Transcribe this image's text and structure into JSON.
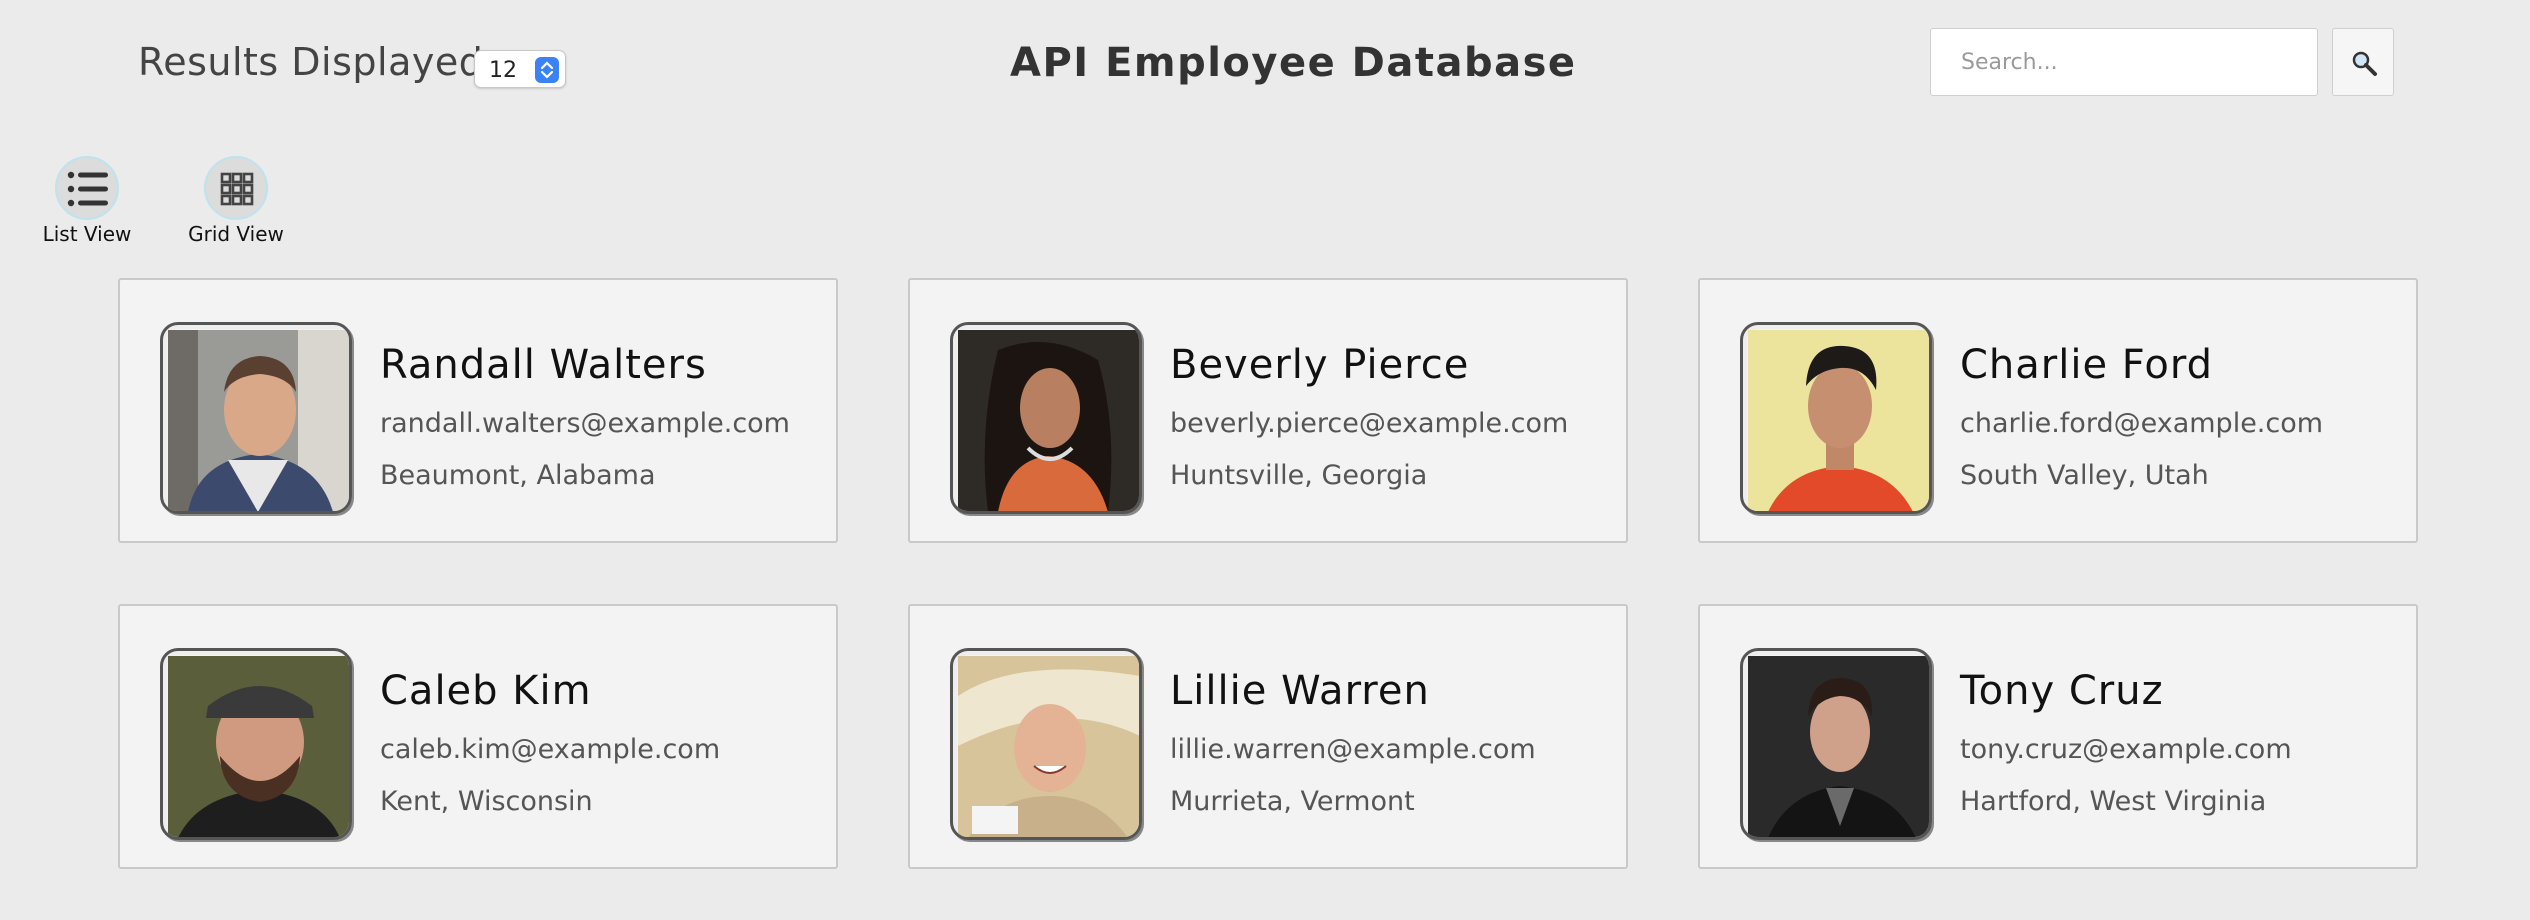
{
  "header": {
    "results_label": "Results Displayed",
    "results_value": "12",
    "title": "API Employee Database",
    "search_placeholder": "Search..."
  },
  "views": {
    "list_label": "List View",
    "grid_label": "Grid View"
  },
  "employees": [
    {
      "name": "Randall Walters",
      "email": "randall.walters@example.com",
      "location": "Beaumont, Alabama"
    },
    {
      "name": "Beverly Pierce",
      "email": "beverly.pierce@example.com",
      "location": "Huntsville, Georgia"
    },
    {
      "name": "Charlie Ford",
      "email": "charlie.ford@example.com",
      "location": "South Valley, Utah"
    },
    {
      "name": "Caleb Kim",
      "email": "caleb.kim@example.com",
      "location": "Kent, Wisconsin"
    },
    {
      "name": "Lillie Warren",
      "email": "lillie.warren@example.com",
      "location": "Murrieta, Vermont"
    },
    {
      "name": "Tony Cruz",
      "email": "tony.cruz@example.com",
      "location": "Hartford, West Virginia"
    }
  ],
  "colors": {
    "accent": "#3b82f6",
    "card_bg": "#f3f3f3",
    "page_bg": "#ebebeb"
  }
}
